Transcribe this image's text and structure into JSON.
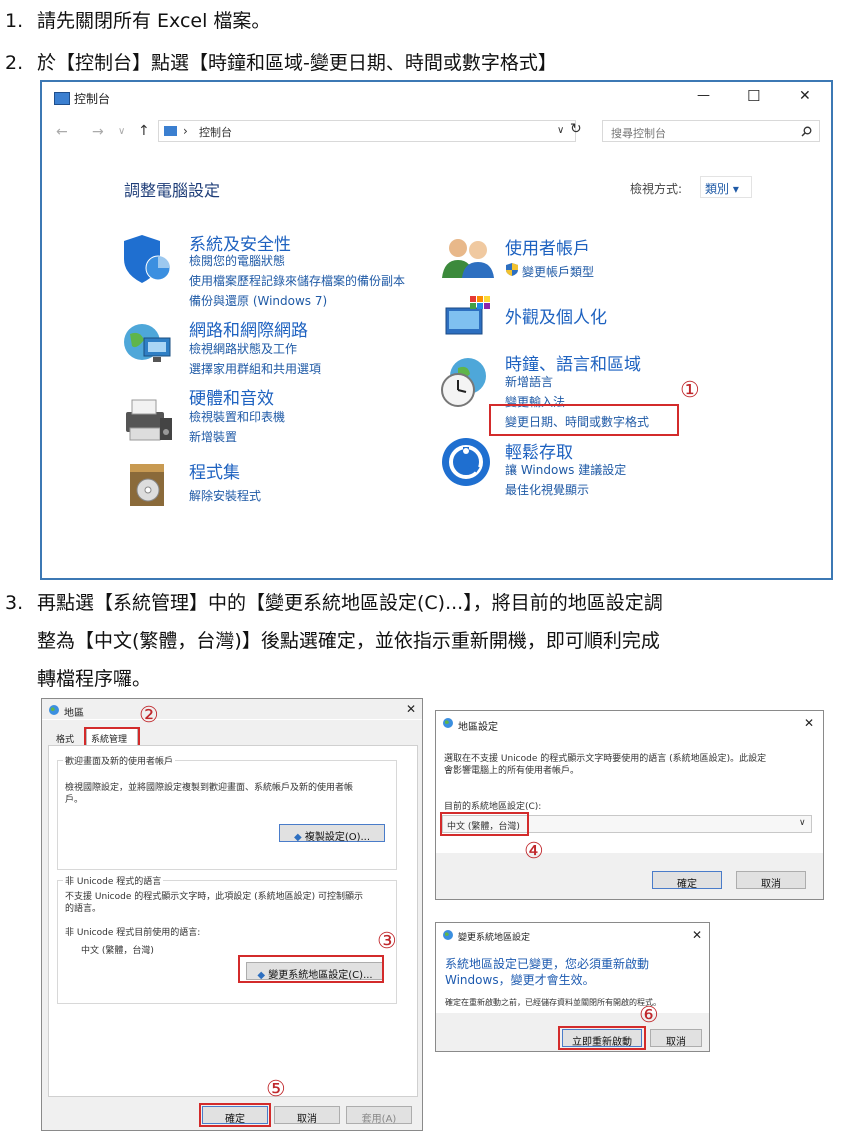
{
  "steps": [
    {
      "num": "1.",
      "text": "請先關閉所有 Excel 檔案。"
    },
    {
      "num": "2.",
      "text": "於【控制台】點選【時鐘和區域-變更日期、時間或數字格式】"
    },
    {
      "num": "3.",
      "lines": [
        "再點選【系統管理】中的【變更系統地區設定(C)...】，將目前的地區設定調",
        "整為【中文(繁體，台灣)】後點選確定，並依指示重新開機，即可順利完成",
        "轉檔程序囉。"
      ]
    }
  ],
  "control_panel": {
    "title": "控制台",
    "window_buttons": [
      "—",
      "☐",
      "✕"
    ],
    "nav": {
      "back": "←",
      "forward": "→",
      "down": "∨",
      "up": "↑",
      "path_sep": "›",
      "path": "控制台",
      "dropdown": "∨",
      "refresh": "↻"
    },
    "search_placeholder": "搜尋控制台",
    "heading": "調整電腦設定",
    "view_by_label": "檢視方式:",
    "view_by_value": "類別 ▾",
    "categories_left": [
      {
        "title": "系統及安全性",
        "links": [
          "檢閱您的電腦狀態",
          "使用檔案歷程記錄來儲存檔案的備份副本",
          "備份與還原 (Windows 7)"
        ]
      },
      {
        "title": "網路和網際網路",
        "links": [
          "檢視網路狀態及工作",
          "選擇家用群組和共用選項"
        ]
      },
      {
        "title": "硬體和音效",
        "links": [
          "檢視裝置和印表機",
          "新增裝置"
        ]
      },
      {
        "title": "程式集",
        "links": [
          "解除安裝程式"
        ]
      }
    ],
    "categories_right": [
      {
        "title": "使用者帳戶",
        "links": [
          "變更帳戶類型"
        ]
      },
      {
        "title": "外觀及個人化",
        "links": []
      },
      {
        "title": "時鐘、語言和區域",
        "links": [
          "新增語言",
          "變更輸入法",
          "變更日期、時間或數字格式"
        ]
      },
      {
        "title": "輕鬆存取",
        "links": [
          "讓 Windows 建議設定",
          "最佳化視覺顯示"
        ]
      }
    ]
  },
  "region_dialog": {
    "title": "地區",
    "close": "✕",
    "tabs": [
      "格式",
      "系統管理"
    ],
    "group1_title": "歡迎畫面及新的使用者帳戶",
    "group1_text": [
      "檢視國際設定，並將國際設定複製到歡迎畫面、系統帳戶及新的使用者帳",
      "戶。"
    ],
    "copy_button": "複製設定(O)...",
    "group2_title": "非 Unicode 程式的語言",
    "group2_text": [
      "不支援 Unicode 的程式顯示文字時，此項設定 (系統地區設定) 可控制顯示",
      "的語言。"
    ],
    "current_label": "非 Unicode 程式目前使用的語言:",
    "current_value": "中文 (繁體，台灣)",
    "change_button": "變更系統地區設定(C)...",
    "ok": "確定",
    "cancel": "取消",
    "apply": "套用(A)"
  },
  "region_settings": {
    "title": "地區設定",
    "close": "✕",
    "desc": [
      "選取在不支援 Unicode 的程式顯示文字時要使用的語言 (系統地區設定)。此設定",
      "會影響電腦上的所有使用者帳戶。"
    ],
    "label": "目前的系統地區設定(C):",
    "value": "中文 (繁體，台灣)",
    "ok": "確定",
    "cancel": "取消"
  },
  "change_dialog": {
    "title": "變更系統地區設定",
    "close": "✕",
    "heading": [
      "系統地區設定已變更，您必須重新啟動",
      "Windows，變更才會生效。"
    ],
    "text": "確定在重新啟動之前，已經儲存資料並關閉所有開啟的程式。",
    "restart": "立即重新啟動",
    "cancel": "取消"
  },
  "markers": [
    "①",
    "②",
    "③",
    "④",
    "⑤",
    "⑥"
  ],
  "colors": {
    "highlight": "#d32b2b",
    "link": "#1f5aa6",
    "category": "#1e62c0",
    "window_border": "#3c78b4"
  }
}
